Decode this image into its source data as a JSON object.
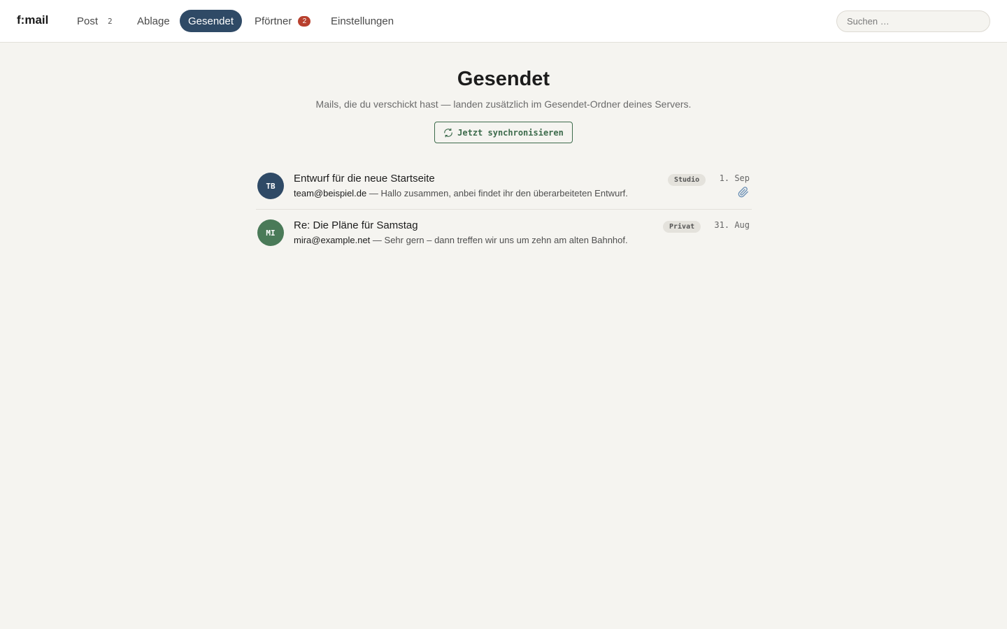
{
  "app": {
    "logo": "f:mail"
  },
  "nav": {
    "post": {
      "label": "Post",
      "count": "2"
    },
    "ablage": {
      "label": "Ablage"
    },
    "gesendet": {
      "label": "Gesendet"
    },
    "pfoertner": {
      "label": "Pförtner",
      "count": "2"
    },
    "einstellungen": {
      "label": "Einstellungen"
    }
  },
  "search": {
    "placeholder": "Suchen …",
    "value": ""
  },
  "header": {
    "title": "Gesendet",
    "subtitle": "Mails, die du verschickt hast — landen zusätzlich im Gesendet-Ordner deines Servers.",
    "sync_label": "Jetzt synchronisieren",
    "sync_icon": "refresh-icon"
  },
  "mails": [
    {
      "initials": "TB",
      "avatar_color": "#2f4a66",
      "subject": "Entwurf für die neue Startseite",
      "recipient": "team@beispiel.de",
      "separator": " — ",
      "snippet": "Hallo zusammen, anbei findet ihr den überarbeiteten Entwurf.",
      "tag": "Studio",
      "date": "1. Sep",
      "has_attachment": true,
      "attachment_icon": "paperclip-icon"
    },
    {
      "initials": "MI",
      "avatar_color": "#4a7a58",
      "subject": "Re: Die Pläne für Samstag",
      "recipient": "mira@example.net",
      "separator": " — ",
      "snippet": "Sehr gern – dann treffen wir uns um zehn am alten Bahnhof.",
      "tag": "Privat",
      "date": "31. Aug",
      "has_attachment": false
    }
  ],
  "colors": {
    "accent": "#2f4a66",
    "sync": "#3d6b4c",
    "badge": "#b8402e",
    "background": "#f5f4f0"
  }
}
